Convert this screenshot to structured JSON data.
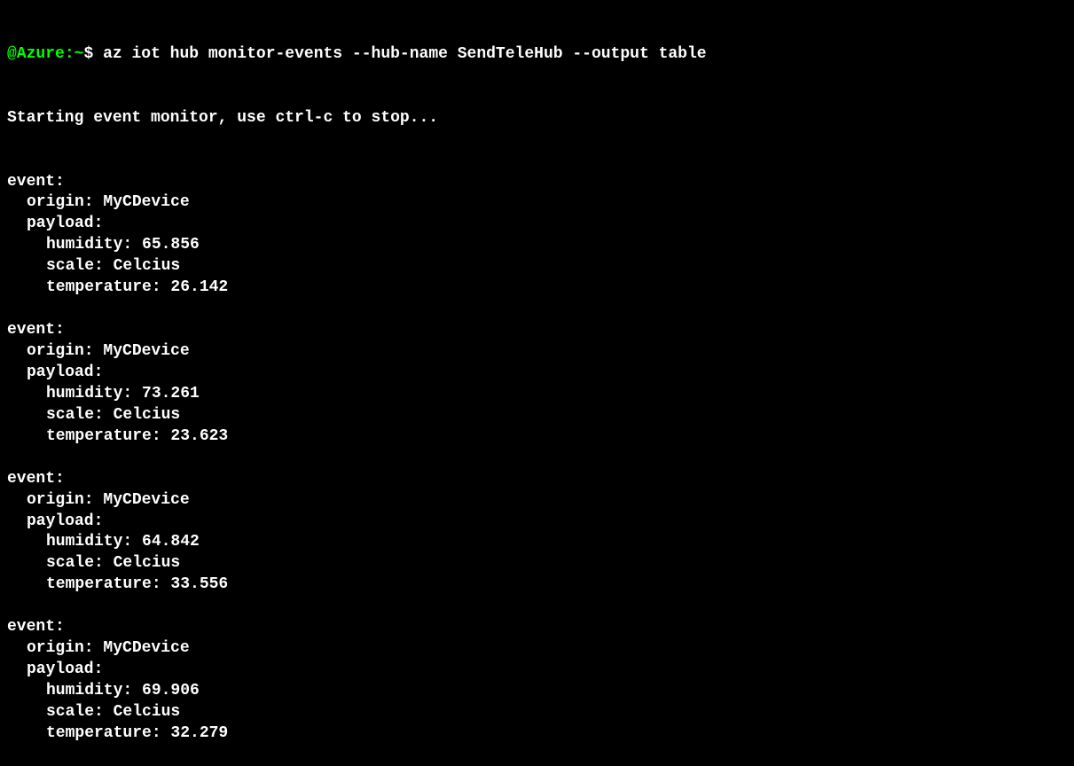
{
  "prompt": {
    "user": "@Azure",
    "separator": ":",
    "path": "~",
    "dollar": "$"
  },
  "command": "az iot hub monitor-events --hub-name SendTeleHub --output table",
  "startMessage": "Starting event monitor, use ctrl-c to stop...",
  "labels": {
    "event": "event:",
    "origin": "origin:",
    "payload": "payload:",
    "humidity": "humidity:",
    "scale": "scale:",
    "temperature": "temperature:"
  },
  "events": [
    {
      "origin": "MyCDevice",
      "humidity": "65.856",
      "scale": "Celcius",
      "temperature": "26.142"
    },
    {
      "origin": "MyCDevice",
      "humidity": "73.261",
      "scale": "Celcius",
      "temperature": "23.623"
    },
    {
      "origin": "MyCDevice",
      "humidity": "64.842",
      "scale": "Celcius",
      "temperature": "33.556"
    },
    {
      "origin": "MyCDevice",
      "humidity": "69.906",
      "scale": "Celcius",
      "temperature": "32.279"
    }
  ]
}
